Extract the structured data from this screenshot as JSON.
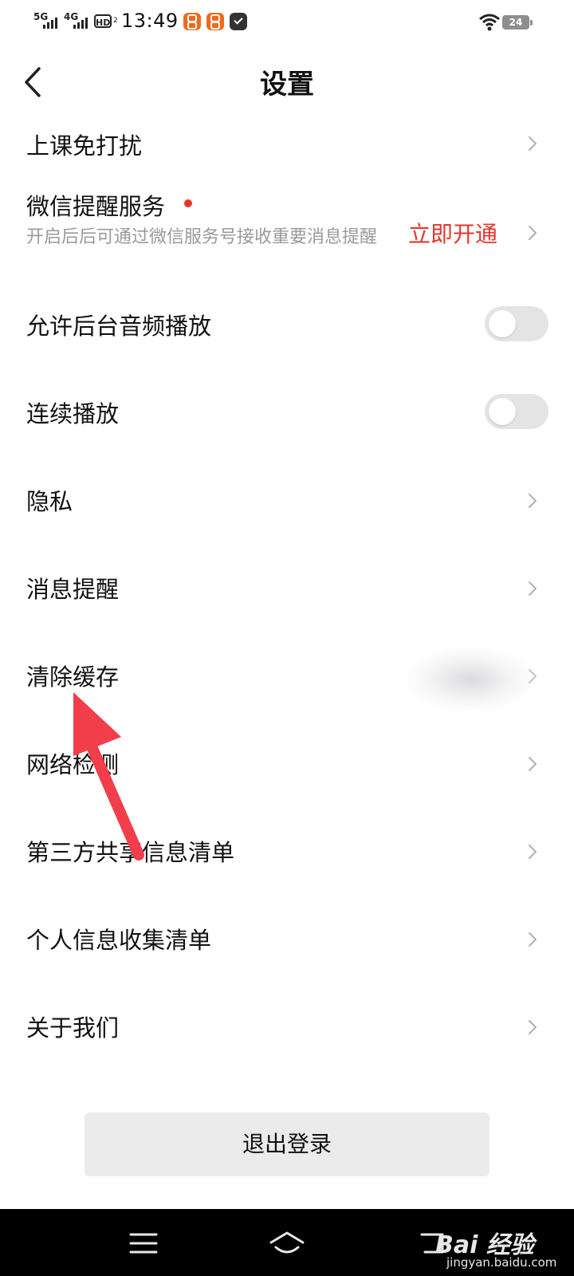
{
  "status_bar": {
    "network1": "5G",
    "network2": "4G",
    "hd_label": "HD",
    "hd_sub": "2",
    "time": "13:49",
    "battery": "24"
  },
  "header": {
    "title": "设置"
  },
  "settings": {
    "class_dnd": "上课免打扰",
    "wechat_reminder": {
      "label": "微信提醒服务",
      "description": "开启后后可通过微信服务号接收重要消息提醒",
      "action": "立即开通"
    },
    "background_audio": {
      "label": "允许后台音频播放",
      "enabled": false
    },
    "continuous_play": {
      "label": "连续播放",
      "enabled": false
    },
    "privacy": "隐私",
    "message_reminder": "消息提醒",
    "clear_cache": "清除缓存",
    "network_check": "网络检测",
    "third_party_list": "第三方共享信息清单",
    "personal_info_list": "个人信息收集清单",
    "about_us": "关于我们"
  },
  "logout_button": "退出登录",
  "watermark": {
    "brand": "Bai 经验",
    "url": "jingyan.baidu.com"
  },
  "colors": {
    "accent_red": "#e4372d",
    "annotation_arrow": "#f23d4a"
  }
}
